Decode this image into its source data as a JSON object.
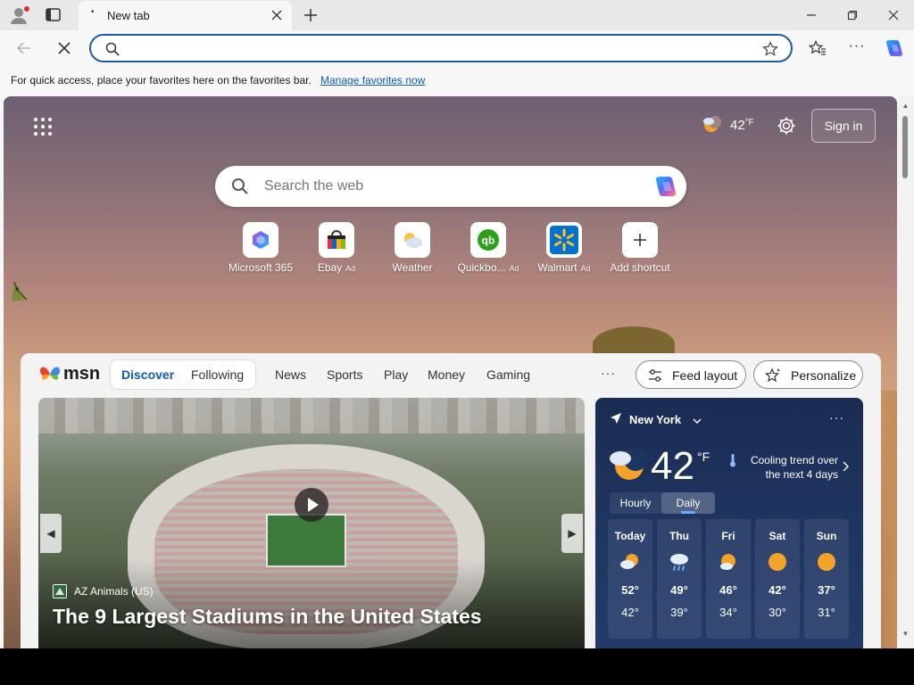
{
  "browser": {
    "tab_title": "New tab",
    "tab_dot": "•"
  },
  "favorites_bar": {
    "message": "For quick access, place your favorites here on the favorites bar.",
    "link": "Manage favorites now"
  },
  "ntp": {
    "weather_temp": "42",
    "weather_unit": "°F",
    "sign_in": "Sign in",
    "search_placeholder": "Search the web",
    "shortcuts": [
      {
        "label": "Microsoft 365",
        "ad": "",
        "icon": "microsoft-365-icon"
      },
      {
        "label": "Ebay",
        "ad": "Ad",
        "icon": "ebay-icon"
      },
      {
        "label": "Weather",
        "ad": "",
        "icon": "weather-icon"
      },
      {
        "label": "Quickbo...",
        "ad": "Ad",
        "icon": "quickbooks-icon"
      },
      {
        "label": "Walmart",
        "ad": "Ad",
        "icon": "walmart-icon"
      },
      {
        "label": "Add shortcut",
        "ad": "",
        "icon": "plus-icon"
      }
    ]
  },
  "feed": {
    "logo": "msn",
    "tabs": [
      "Discover",
      "Following"
    ],
    "categories": [
      "News",
      "Sports",
      "Play",
      "Money",
      "Gaming"
    ],
    "more": "···",
    "feed_layout": "Feed layout",
    "personalize": "Personalize",
    "hero": {
      "source": "AZ Animals (US)",
      "headline": "The 9 Largest Stadiums in the United States"
    }
  },
  "weather": {
    "location": "New York",
    "more": "···",
    "temp": "42",
    "unit": "°F",
    "trend_line1": "Cooling trend over",
    "trend_line2": "the next 4 days",
    "tabs": [
      "Hourly",
      "Daily"
    ],
    "days": [
      {
        "name": "Today",
        "hi": "52°",
        "lo": "42°",
        "icon": "partly-sunny-icon"
      },
      {
        "name": "Thu",
        "hi": "49°",
        "lo": "39°",
        "icon": "rain-icon"
      },
      {
        "name": "Fri",
        "hi": "46°",
        "lo": "34°",
        "icon": "partly-sunny-icon"
      },
      {
        "name": "Sat",
        "hi": "42°",
        "lo": "30°",
        "icon": "sunny-icon"
      },
      {
        "name": "Sun",
        "hi": "37°",
        "lo": "31°",
        "icon": "sunny-icon"
      }
    ]
  },
  "colors": {
    "accent": "#0f5bb5",
    "omnibox_border": "#1e5aa8",
    "weather_card": "#1f3561"
  }
}
